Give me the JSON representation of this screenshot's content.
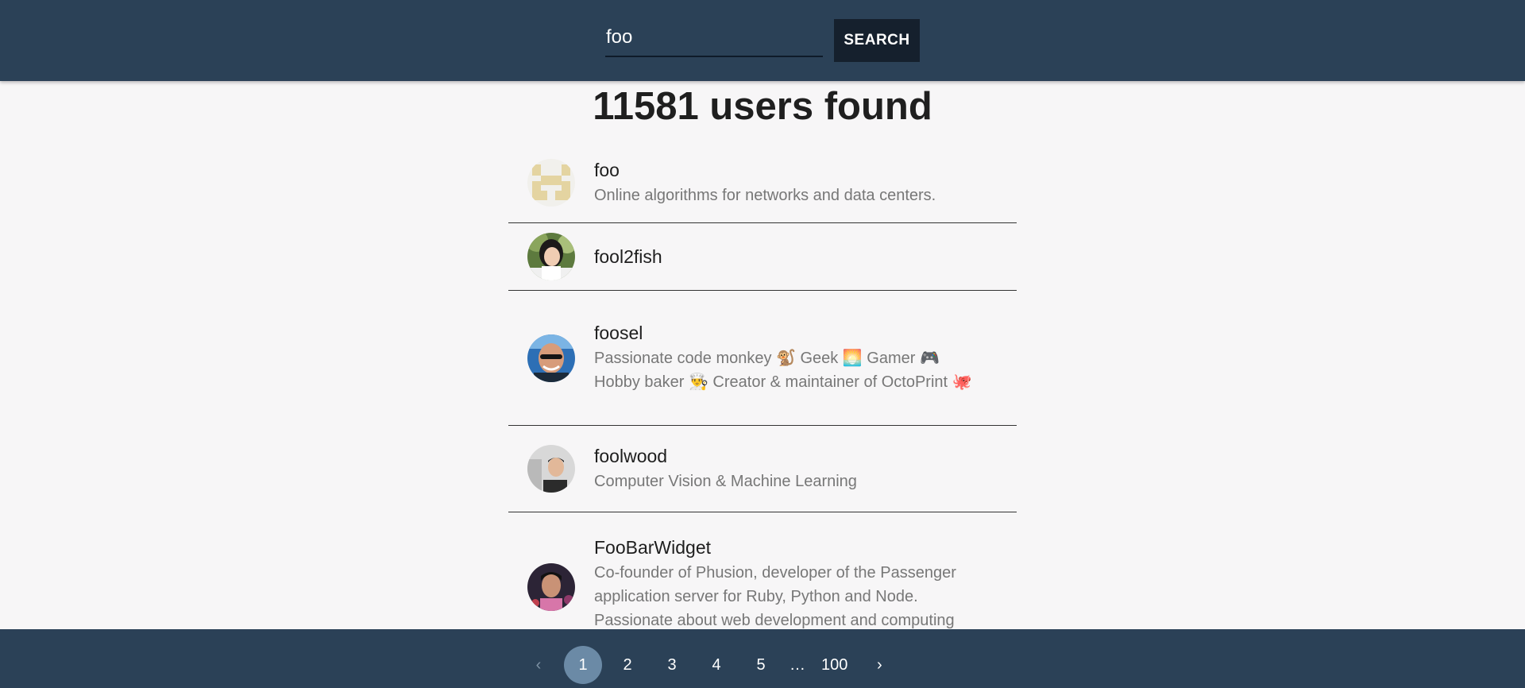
{
  "colors": {
    "header_bg": "#2b4157",
    "button_bg": "#15202d",
    "page_bg": "#f7f6f7",
    "active_page_bg": "#6b8aa6"
  },
  "search": {
    "value": "foo",
    "button_label": "SEARCH"
  },
  "results": {
    "title": "11581 users found",
    "users": [
      {
        "login": "foo",
        "bio": "Online algorithms for networks and data centers.",
        "avatar_icon": "identicon-avatar"
      },
      {
        "login": "fool2fish",
        "bio": "",
        "avatar_icon": "user-photo-avatar"
      },
      {
        "login": "foosel",
        "bio": "Passionate code monkey 🐒 Geek 🌅 Gamer 🎮 Hobby baker 👨‍🍳 Creator & maintainer of OctoPrint 🐙",
        "avatar_icon": "user-photo-avatar"
      },
      {
        "login": "foolwood",
        "bio": "Computer Vision & Machine Learning",
        "avatar_icon": "user-photo-avatar"
      },
      {
        "login": "FooBarWidget",
        "bio": "Co-founder of Phusion, developer of the Passenger application server for Ruby, Python and Node. Passionate about web development and computing",
        "avatar_icon": "user-photo-avatar"
      }
    ]
  },
  "pagination": {
    "prev_icon": "chevron-left-icon",
    "next_icon": "chevron-right-icon",
    "prev_glyph": "‹",
    "next_glyph": "›",
    "pages": [
      "1",
      "2",
      "3",
      "4",
      "5"
    ],
    "ellipsis": "…",
    "last_page": "100",
    "current": "1"
  }
}
